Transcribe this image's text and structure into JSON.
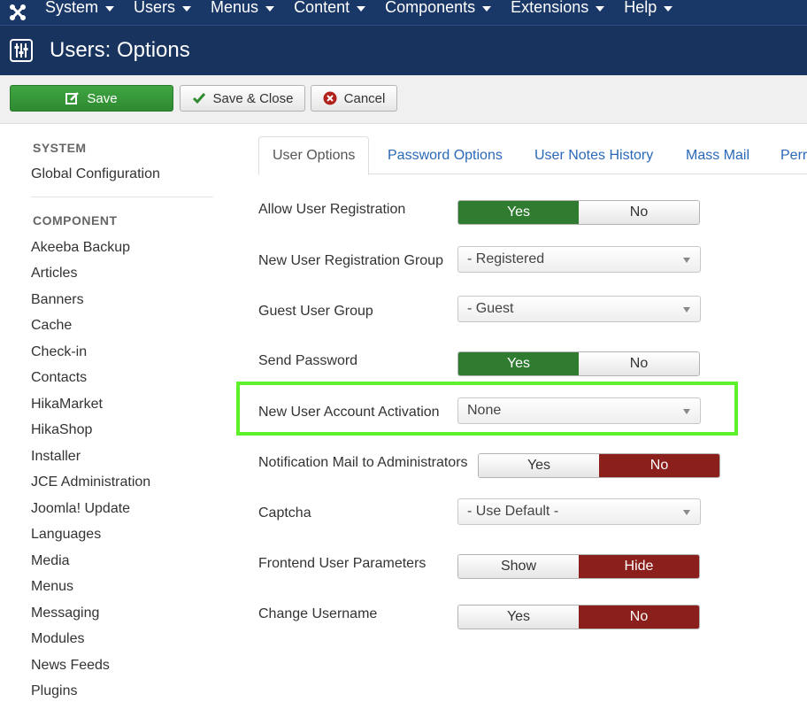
{
  "topnav": {
    "logo_icon": "joomla-logo-icon",
    "items": [
      {
        "label": "System"
      },
      {
        "label": "Users"
      },
      {
        "label": "Menus"
      },
      {
        "label": "Content"
      },
      {
        "label": "Components"
      },
      {
        "label": "Extensions"
      },
      {
        "label": "Help"
      }
    ]
  },
  "header": {
    "icon": "sliders-icon",
    "title": "Users: Options"
  },
  "toolbar": {
    "save_label": "Save",
    "save_close_label": "Save & Close",
    "cancel_label": "Cancel"
  },
  "sidebar": {
    "system_heading": "SYSTEM",
    "global_config": "Global Configuration",
    "component_heading": "COMPONENT",
    "components": [
      "Akeeba Backup",
      "Articles",
      "Banners",
      "Cache",
      "Check-in",
      "Contacts",
      "HikaMarket",
      "HikaShop",
      "Installer",
      "JCE Administration",
      "Joomla! Update",
      "Languages",
      "Media",
      "Menus",
      "Messaging",
      "Modules",
      "News Feeds",
      "Plugins"
    ]
  },
  "tabs": [
    {
      "label": "User Options",
      "active": true
    },
    {
      "label": "Password Options"
    },
    {
      "label": "User Notes History"
    },
    {
      "label": "Mass Mail"
    },
    {
      "label": "Perr"
    }
  ],
  "form": {
    "allow_registration": {
      "label": "Allow User Registration",
      "on": "Yes",
      "off": "No",
      "selected": "Yes"
    },
    "registration_group": {
      "label": "New User Registration Group",
      "value": "- Registered"
    },
    "guest_group": {
      "label": "Guest User Group",
      "value": "- Guest"
    },
    "send_password": {
      "label": "Send Password",
      "on": "Yes",
      "off": "No",
      "selected": "Yes"
    },
    "account_activation": {
      "label": "New User Account Activation",
      "value": "None"
    },
    "notification_mail": {
      "label": "Notification Mail to Administrators",
      "on": "Yes",
      "off": "No",
      "selected": "No"
    },
    "captcha": {
      "label": "Captcha",
      "value": "- Use Default -"
    },
    "frontend_params": {
      "label": "Frontend User Parameters",
      "on": "Show",
      "off": "Hide",
      "selected": "Hide"
    },
    "change_username": {
      "label": "Change Username",
      "on": "Yes",
      "off": "No",
      "selected": "No"
    }
  },
  "colors": {
    "nav_bg": "#1a3867",
    "header_bg": "#17335e",
    "save_green": "#2f8a31",
    "toggle_yes": "#2f7c31",
    "toggle_no": "#8a1f1b",
    "highlight": "#5cf12a",
    "link_blue": "#2a69b8"
  }
}
